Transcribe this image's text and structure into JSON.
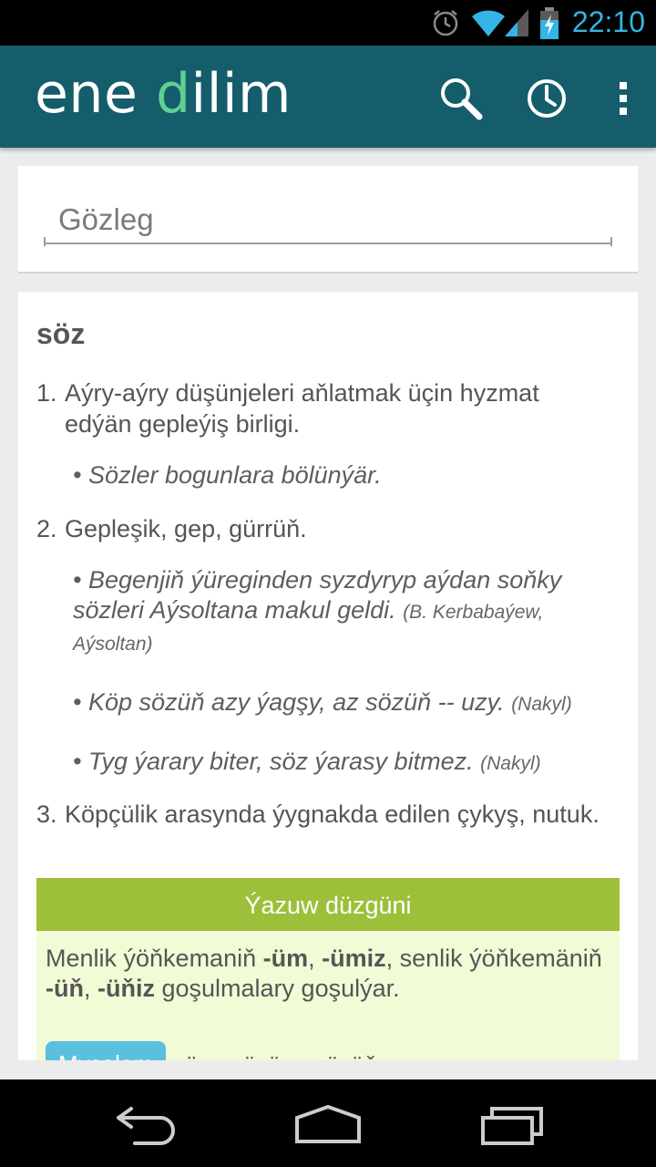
{
  "status_bar": {
    "time": "22:10",
    "icons": [
      "alarm-icon",
      "wifi-icon",
      "signal-icon",
      "battery-charging-icon"
    ]
  },
  "app_bar": {
    "logo_prefix": "ene ",
    "logo_accent": "d",
    "logo_suffix": "ilim",
    "actions": [
      "search-icon",
      "history-icon",
      "overflow-menu-icon"
    ]
  },
  "search": {
    "placeholder": "Gözleg",
    "value": ""
  },
  "entry": {
    "word": "söz",
    "senses": [
      {
        "number": "1.",
        "text": "Aýry-aýry düşünjeleri aňlatmak üçin hyzmat edýän gepleýiş birligi.",
        "examples": [
          {
            "text": "• Sözler bogunlara bölünýär.",
            "source": ""
          }
        ]
      },
      {
        "number": "2.",
        "text": "Gepleşik, gep, gürrüň.",
        "examples": [
          {
            "text": "• Begenjiň ýüreginden syzdyryp aýdan soňky sözleri Aýsoltana makul geldi.",
            "source": "(B. Kerbabaýew, Aýsoltan)"
          },
          {
            "text": "• Köp sözüň azy ýagşy, az sözüň -- uzy.",
            "source": "(Nakyl)"
          },
          {
            "text": "• Tyg ýarary biter, söz ýarasy bitmez.",
            "source": "(Nakyl)"
          }
        ]
      },
      {
        "number": "3.",
        "text": "Köpçülik arasynda ýygnakda edilen çykyş, nutuk.",
        "examples": []
      }
    ]
  },
  "rule": {
    "header": "Ýazuw düzgüni",
    "text_parts": {
      "p1": "Menlik ýöňkemaniň ",
      "b1": "-üm",
      "p2": ", ",
      "b2": "-ümiz",
      "p3": ", senlik ýöňkemäniň ",
      "b3": "-üň",
      "p4": ", ",
      "b4": "-üňiz",
      "p5": " goşulmalary goşulýar."
    },
    "example_chip": "Mysalam",
    "example_text": "söz - sözüm, sözüň"
  },
  "nav_bar": {
    "buttons": [
      "back-icon",
      "home-icon",
      "recents-icon"
    ]
  },
  "colors": {
    "app_bar": "#155d6b",
    "logo_accent": "#5fd08f",
    "rule_header": "#9cc03a",
    "rule_body": "#f1fbd6",
    "chip": "#5bc0de",
    "status_text": "#33b5e5"
  }
}
